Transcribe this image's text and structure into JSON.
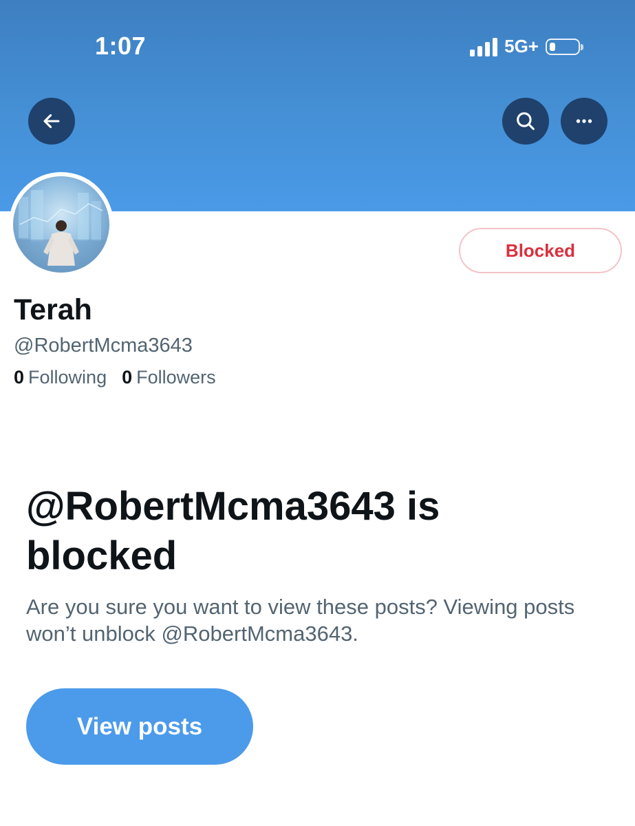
{
  "status_bar": {
    "time": "1:07",
    "network": "5G+",
    "signal_bars": 4,
    "battery_level": 0.2
  },
  "header": {
    "back_icon": "back-arrow-icon",
    "search_icon": "search-icon",
    "more_icon": "more-horizontal-icon",
    "banner_color": "#4590d6"
  },
  "profile": {
    "display_name": "Terah",
    "handle": "@RobertMcma3643",
    "following_count": "0",
    "following_label": "Following",
    "followers_count": "0",
    "followers_label": "Followers",
    "blocked_button_label": "Blocked",
    "blocked_color": "#d9303d"
  },
  "blocked_notice": {
    "title": "@RobertMcma3643 is blocked",
    "description": "Are you sure you want to view these posts? Viewing posts won’t unblock @RobertMcma3643.",
    "view_button_label": "View posts",
    "button_color": "#4c9bea"
  }
}
